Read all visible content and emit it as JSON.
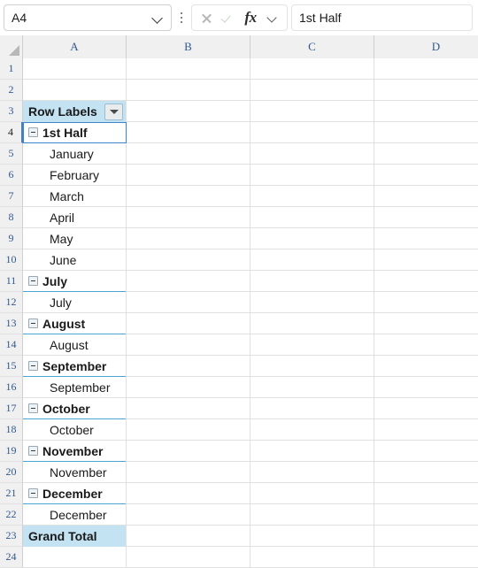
{
  "formula_bar": {
    "name_box_value": "A4",
    "name_box_dropdown_icon": "chevron-down-icon",
    "options_icon": "kebab-menu-icon",
    "cancel_icon": "cancel-x-icon",
    "confirm_icon": "confirm-check-icon",
    "function_icon": "fx-insert-function-icon",
    "function_dropdown_icon": "chevron-down-icon",
    "formula_value": "1st Half",
    "formula_placeholder": ""
  },
  "grid": {
    "select_all_icon": "select-all-corner-icon",
    "columns": [
      "A",
      "B",
      "C",
      "D"
    ],
    "rows": [
      "1",
      "2",
      "3",
      "4",
      "5",
      "6",
      "7",
      "8",
      "9",
      "10",
      "11",
      "12",
      "13",
      "14",
      "15",
      "16",
      "17",
      "18",
      "19",
      "20",
      "21",
      "22",
      "23",
      "24"
    ],
    "selected_cell": "A4",
    "accent_color": "#3a86c8",
    "pivot_header_fill": "#c3e2f2",
    "group_underline_color": "#4da3d6"
  },
  "pivot_table": {
    "header_label": "Row Labels",
    "filter_icon": "filter-dropdown-icon",
    "collapse_icon": "collapse-minus-icon",
    "rows": [
      {
        "row": "4",
        "text": "1st Half",
        "type": "group"
      },
      {
        "row": "5",
        "text": "January",
        "type": "child"
      },
      {
        "row": "6",
        "text": "February",
        "type": "child"
      },
      {
        "row": "7",
        "text": "March",
        "type": "child"
      },
      {
        "row": "8",
        "text": "April",
        "type": "child"
      },
      {
        "row": "9",
        "text": "May",
        "type": "child"
      },
      {
        "row": "10",
        "text": "June",
        "type": "child"
      },
      {
        "row": "11",
        "text": "July",
        "type": "group"
      },
      {
        "row": "12",
        "text": "July",
        "type": "child"
      },
      {
        "row": "13",
        "text": "August",
        "type": "group"
      },
      {
        "row": "14",
        "text": "August",
        "type": "child"
      },
      {
        "row": "15",
        "text": "September",
        "type": "group"
      },
      {
        "row": "16",
        "text": "September",
        "type": "child"
      },
      {
        "row": "17",
        "text": "October",
        "type": "group"
      },
      {
        "row": "18",
        "text": "October",
        "type": "child"
      },
      {
        "row": "19",
        "text": "November",
        "type": "group"
      },
      {
        "row": "20",
        "text": "November",
        "type": "child"
      },
      {
        "row": "21",
        "text": "December",
        "type": "group"
      },
      {
        "row": "22",
        "text": "December",
        "type": "child"
      }
    ],
    "grand_total_label": "Grand Total"
  }
}
